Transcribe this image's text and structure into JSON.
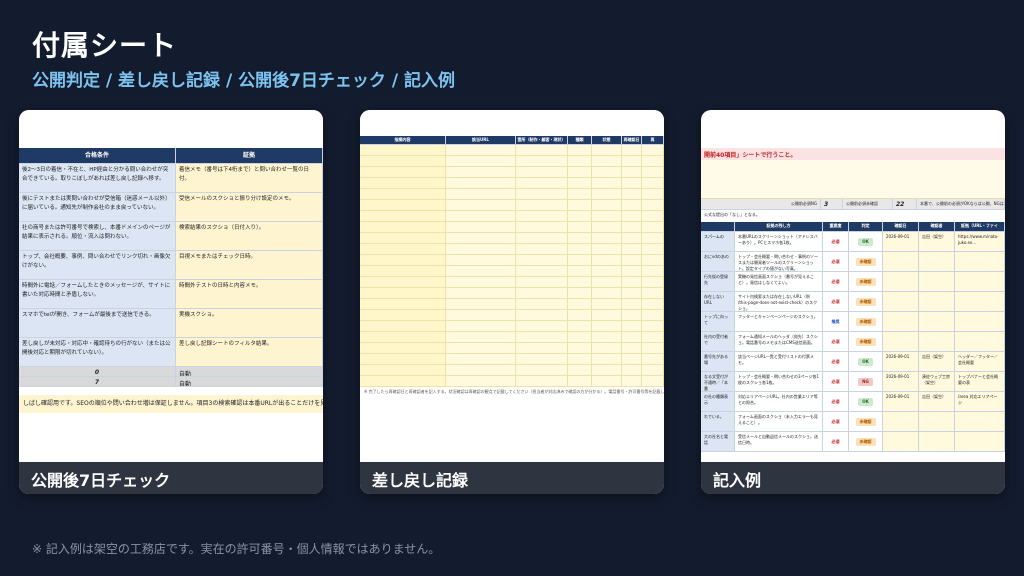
{
  "title": "付属シート",
  "subtitle": "公開判定 / 差し戻し記録 / 公開後7日チェック / 記入例",
  "cards": [
    {
      "caption": "公開後7日チェック",
      "headers": [
        "合格条件",
        "証拠"
      ],
      "rows": [
        [
          "後2〜3日の着信・不在と、HP経由と分かる問い合わせが突合できている。取りこぼしがあれば差し戻し記録へ移す。",
          "着信メモ（番号は下4桁まで）と問い合わせ一覧の日付。"
        ],
        [
          "後にテストまたは実問い合わせが受信箱（迷惑メール以外）に届いている。通知先が制作会社のまま戻っていない。",
          "受信メールのスクショと振り分け設定のメモ。"
        ],
        [
          "社の商号または許可番号で検索し、本番ドメインのページが結果に表示される。順位・流入は問わない。",
          "検索結果のスクショ（日付入り）。"
        ],
        [
          "トップ、会社概要、事例、問い合わせでリンク切れ・画像欠けがない。",
          "目視メモまたはチェック日時。"
        ],
        [
          "時間外に電話／フォームしたときのメッセージが、サイトに書いた対応時間と矛盾しない。",
          "時間外テストの日時と内容メモ。"
        ],
        [
          "スマホでtelが開き、フォームが最後まで送信できる。",
          "実機スクショ。"
        ],
        [
          "差し戻しが未対応・対応中・確認待ちの行がない（または公開後対応と期限が切れていない）。",
          "差し戻し記録シートのフィルタ結果。"
        ]
      ],
      "summary": [
        [
          "0",
          "自動"
        ],
        [
          "7",
          "自動"
        ]
      ],
      "footnote": "しばし確認用です。SEOの順位や問い合わせ増は保証しません。項目3の検索確認は本番URLが出ることだけを見ます。"
    },
    {
      "caption": "差し戻し記録",
      "headers": [
        "指摘内容",
        "該当URL",
        "箇所（制作・顧客・現状）",
        "種類",
        "状態",
        "再確認日",
        "再"
      ],
      "footnote": "※ 完了したら再確認日と再確認者を記入する。状況確認は再確認の観点で記載してください（担当者が対応済みで確認の方が分かる）。電話番号・許可番号等を記載してください。"
    },
    {
      "caption": "記入例",
      "banner": "開前40項目」シートで行うこと。",
      "stats": [
        "公開前必須NG",
        "3",
        "公開前必須未確認",
        "22",
        "本番で、公開前の必須がOKならば公開、NGは"
      ],
      "note_row": "公式な提出の「なし」となる。",
      "headers": [
        "証拠の残し方",
        "重要度",
        "判定",
        "確認日",
        "確認者",
        "証拠（URL・ファイ"
      ],
      "rows": [
        [
          "スパームの",
          "本番URLのスクリーンショット（アドレスバーあり）。PCとスマホ各1枚。",
          "必須",
          "OK",
          "2026-09-01",
          "吉田（架空）",
          "https://www.minato-juko.ex..."
        ],
        [
          "おにvdのあの",
          "トップ・会社概要・問い合わせ・事例のソースまたは開発者ツールのスクリーンショット。設定タイプの値がない写真。",
          "必須",
          "未確認",
          "",
          "",
          ""
        ],
        [
          "行先仮の登録先",
          "実機の発信画面スクショ（番号が見えること）。発信はしなくてよい。",
          "必須",
          "未確認",
          "",
          "",
          ""
        ],
        [
          "存在しないURL",
          "サイト内検索または存在しないURL（例 /this-page-does-not-exist-check）のスクショ。",
          "必須",
          "未確認",
          "",
          "",
          ""
        ],
        [
          "トップに向って",
          "フッターとキャンペーンページのスクショ。",
          "推奨",
          "未確認",
          "",
          "",
          ""
        ],
        [
          "社内の受付者で",
          "フォーム通知メールのヘッダ（宛先）スクショ。電話番号のメモまたはCMS送信画面。",
          "必須",
          "未確認",
          "",
          "",
          ""
        ],
        [
          "番号先がある場",
          "該当ページURL一覧と受付リストの付票メモ。",
          "必須",
          "OK",
          "2026-09-01",
          "吉田（架空）",
          "ヘッダー／フッター／会社概要"
        ],
        [
          "なる文受付が不通時／「本番",
          "トップ・会社概要・問い合わせの3ページ各1枚のスクショ各1枚。",
          "必須",
          "NG",
          "2026-09-01",
          "湊佐ウェブ工房（架空）",
          "トップバナーと会社概要の表"
        ],
        [
          "の社の種類表示",
          "対応エリアページURL。社内の営業エリア等との照合。",
          "必須",
          "OK",
          "2026-09-01",
          "吉田（架空）",
          "/area 対応エリアページ"
        ],
        [
          "れでいる。",
          "フォーム画面のスクショ（未入力エラーも見えること）。",
          "必須",
          "未確認",
          "",
          "",
          ""
        ],
        [
          "大の社名と電話",
          "受信メールと自動返信メールのスクショ。送信日時。",
          "必須",
          "未確認",
          "",
          "",
          ""
        ]
      ]
    }
  ],
  "note": "※ 記入例は架空の工務店です。実在の許可番号・個人情報ではありません。"
}
